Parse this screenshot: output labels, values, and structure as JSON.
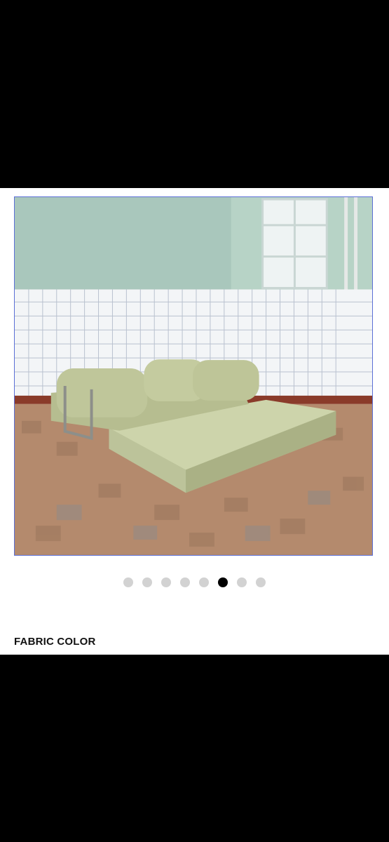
{
  "gallery": {
    "image_alt": "",
    "current_index": 5,
    "total": 8,
    "colors": {
      "active_dot": "#000000",
      "inactive_dot": "#d2d2d2",
      "frame_border": "#5b6fd6"
    }
  },
  "options": {
    "section_label": "FABRIC COLOR"
  }
}
